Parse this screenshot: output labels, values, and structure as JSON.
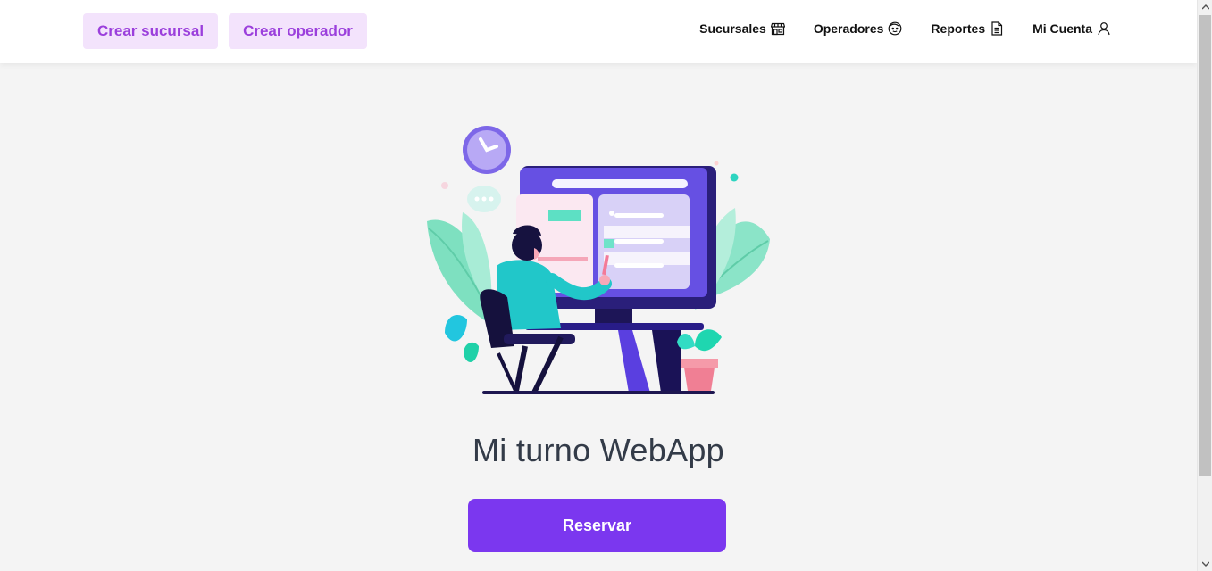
{
  "navbar": {
    "actions": [
      {
        "label": "Crear sucursal"
      },
      {
        "label": "Crear operador"
      }
    ],
    "links": [
      {
        "label": "Sucursales",
        "icon": "store-icon"
      },
      {
        "label": "Operadores",
        "icon": "face-icon"
      },
      {
        "label": "Reportes",
        "icon": "document-icon"
      },
      {
        "label": "Mi Cuenta",
        "icon": "user-icon"
      }
    ]
  },
  "main": {
    "title": "Mi turno WebApp",
    "cta_label": "Reservar",
    "illustration": "person-at-computer-illustration"
  },
  "colors": {
    "accent": "#7b37ef",
    "pill_bg": "#f3e3fc",
    "pill_text": "#9b3fdc",
    "background": "#f4f4f4",
    "title_text": "#333b48"
  }
}
